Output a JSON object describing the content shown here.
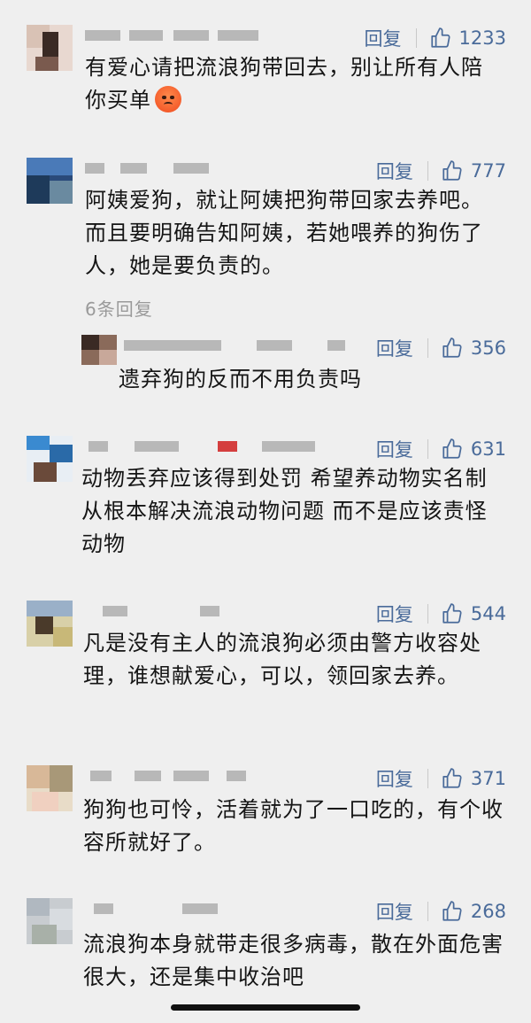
{
  "comments": [
    {
      "reply_label": "回复",
      "likes": "1233",
      "text": "有爱心请把流浪狗带回去，别让所有人陪你买单",
      "emoji": "sad-face-emoji"
    },
    {
      "reply_label": "回复",
      "likes": "777",
      "text": "阿姨爱狗，就让阿姨把狗带回家去养吧。而且要明确告知阿姨，若她喂养的狗伤了人，她是要负责的。",
      "replies_link": "6条回复"
    },
    {
      "reply_label": "回复",
      "likes": "356",
      "text": "遗弃狗的反而不用负责吗"
    },
    {
      "reply_label": "回复",
      "likes": "631",
      "text": "动物丢弃应该得到处罚 希望养动物实名制 从根本解决流浪动物问题 而不是应该责怪动物"
    },
    {
      "reply_label": "回复",
      "likes": "544",
      "text": "凡是没有主人的流浪狗必须由警方收容处理，谁想献爱心，可以，领回家去养。"
    },
    {
      "reply_label": "回复",
      "likes": "371",
      "text": "狗狗也可怜，活着就为了一口吃的，有个收容所就好了。"
    },
    {
      "reply_label": "回复",
      "likes": "268",
      "text": "流浪狗本身就带走很多病毒，散在外面危害很大，还是集中收治吧"
    }
  ],
  "icons": {
    "like": "thumbs-up-icon"
  },
  "colors": {
    "background": "#efefef",
    "action": "#4a6b9a",
    "text": "#151515",
    "muted": "#9a9a9a"
  }
}
